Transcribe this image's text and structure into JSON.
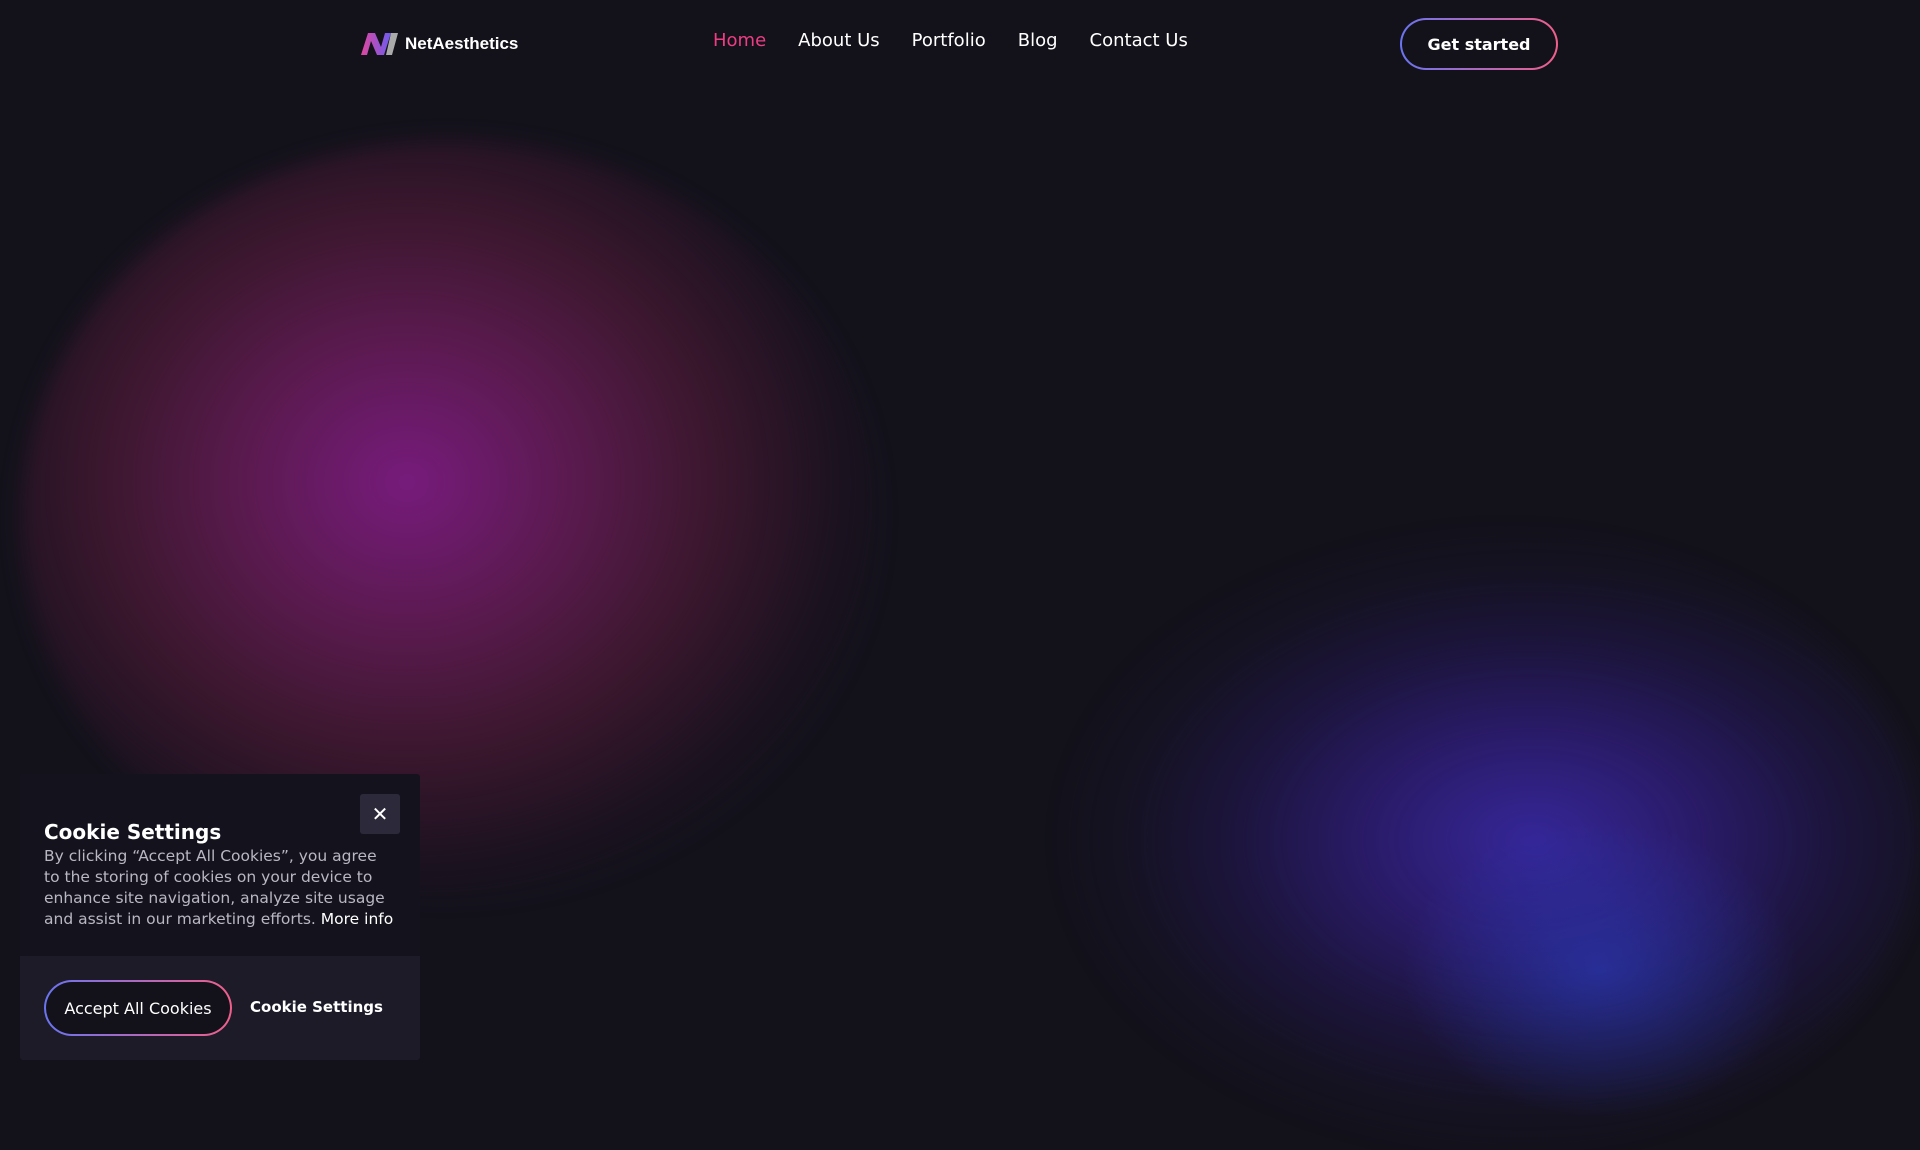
{
  "nav": {
    "brand": "NetAesthetics",
    "links": [
      {
        "label": "Home",
        "active": true
      },
      {
        "label": "About Us"
      },
      {
        "label": "Portfolio"
      },
      {
        "label": "Blog"
      },
      {
        "label": "Contact Us"
      }
    ],
    "cta": "Get started",
    "accent": "#ee3d83"
  },
  "cookie": {
    "title": "Cookie Settings",
    "body": "By clicking “Accept All Cookies”, you agree to the storing of cookies on your device to enhance site navigation, analyze site usage and assist in our marketing efforts.",
    "more_info": "More info",
    "accept": "Accept All Cookies",
    "settings": "Cookie Settings",
    "close_icon": "close-icon"
  }
}
